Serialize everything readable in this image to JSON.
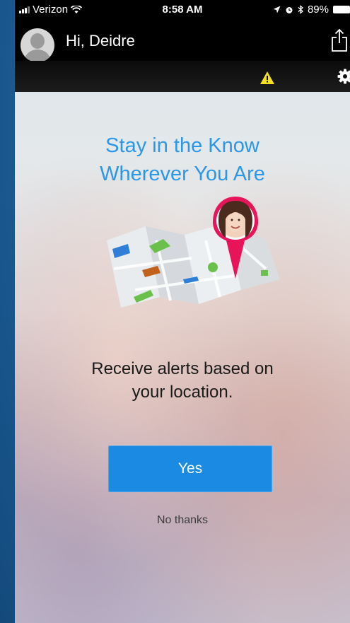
{
  "status_bar": {
    "carrier": "Verizon",
    "time": "8:58 AM",
    "battery": "89%"
  },
  "header": {
    "greeting": "Hi, Deidre"
  },
  "icons": {
    "wifi": "wifi-icon",
    "location": "location-arrow-icon",
    "alarm": "alarm-icon",
    "bluetooth": "bluetooth-icon",
    "share": "share-icon",
    "warning": "warning-icon",
    "settings": "gear-icon"
  },
  "colors": {
    "accent": "#1a8ae3",
    "headline": "#2a97e8",
    "warning": "#f5e11a",
    "pin": "#e8145a"
  },
  "onboarding": {
    "headline_line1": "Stay in the Know",
    "headline_line2": "Wherever You Are",
    "body_line1": "Receive alerts based on",
    "body_line2": "your location.",
    "yes_label": "Yes",
    "no_label": "No thanks"
  }
}
